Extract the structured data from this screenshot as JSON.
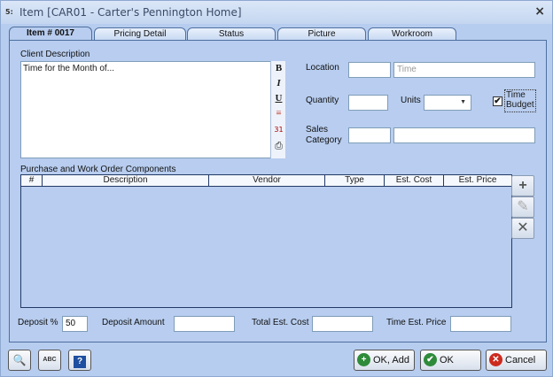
{
  "window": {
    "title": "Item [CAR01 - Carter's Pennington Home]",
    "app_icon": "5:",
    "close": "×"
  },
  "tabs": [
    {
      "label": "Item # 0017",
      "active": true
    },
    {
      "label": "Pricing Detail",
      "active": false
    },
    {
      "label": "Status",
      "active": false
    },
    {
      "label": "Picture",
      "active": false
    },
    {
      "label": "Workroom",
      "active": false
    }
  ],
  "client_description": {
    "label": "Client Description",
    "value": "Time for the Month of...",
    "format_buttons": [
      "B",
      "I",
      "U",
      "≡",
      "31",
      "⎙"
    ]
  },
  "location": {
    "label": "Location",
    "code": "",
    "name": "",
    "name_placeholder": "Time"
  },
  "quantity": {
    "label": "Quantity",
    "value": ""
  },
  "units": {
    "label": "Units",
    "value": ""
  },
  "time_budget": {
    "label_line1": "Time",
    "label_line2": "Budget",
    "checked": true,
    "check_mark": "✔"
  },
  "sales_category": {
    "label_line1": "Sales",
    "label_line2": "Category",
    "code": "",
    "name": ""
  },
  "components": {
    "label": "Purchase and Work Order Components",
    "columns": [
      "#",
      "Description",
      "Vendor",
      "Type",
      "Est. Cost",
      "Est. Price"
    ],
    "rows": [],
    "buttons": {
      "add": "+",
      "edit": "✎",
      "delete": "✕"
    }
  },
  "footer_fields": {
    "deposit_pct_label": "Deposit %",
    "deposit_pct_value": "50",
    "deposit_amount_label": "Deposit Amount",
    "deposit_amount_value": "",
    "total_est_cost_label": "Total Est. Cost",
    "total_est_cost_value": "",
    "time_est_price_label": "Time Est. Price",
    "time_est_price_value": ""
  },
  "buttons": {
    "ok_add": "OK, Add",
    "ok": "OK",
    "cancel": "Cancel",
    "ok_add_icon": "+",
    "ok_icon": "✔",
    "cancel_icon": "✕"
  },
  "tools": {
    "search_icon": "🔍",
    "spell_icon": "ABC",
    "help_icon": "?"
  },
  "colors": {
    "accent_green": "#2e8b3a",
    "cancel_red": "#cc2a1e",
    "panel": "#b8cdef"
  }
}
